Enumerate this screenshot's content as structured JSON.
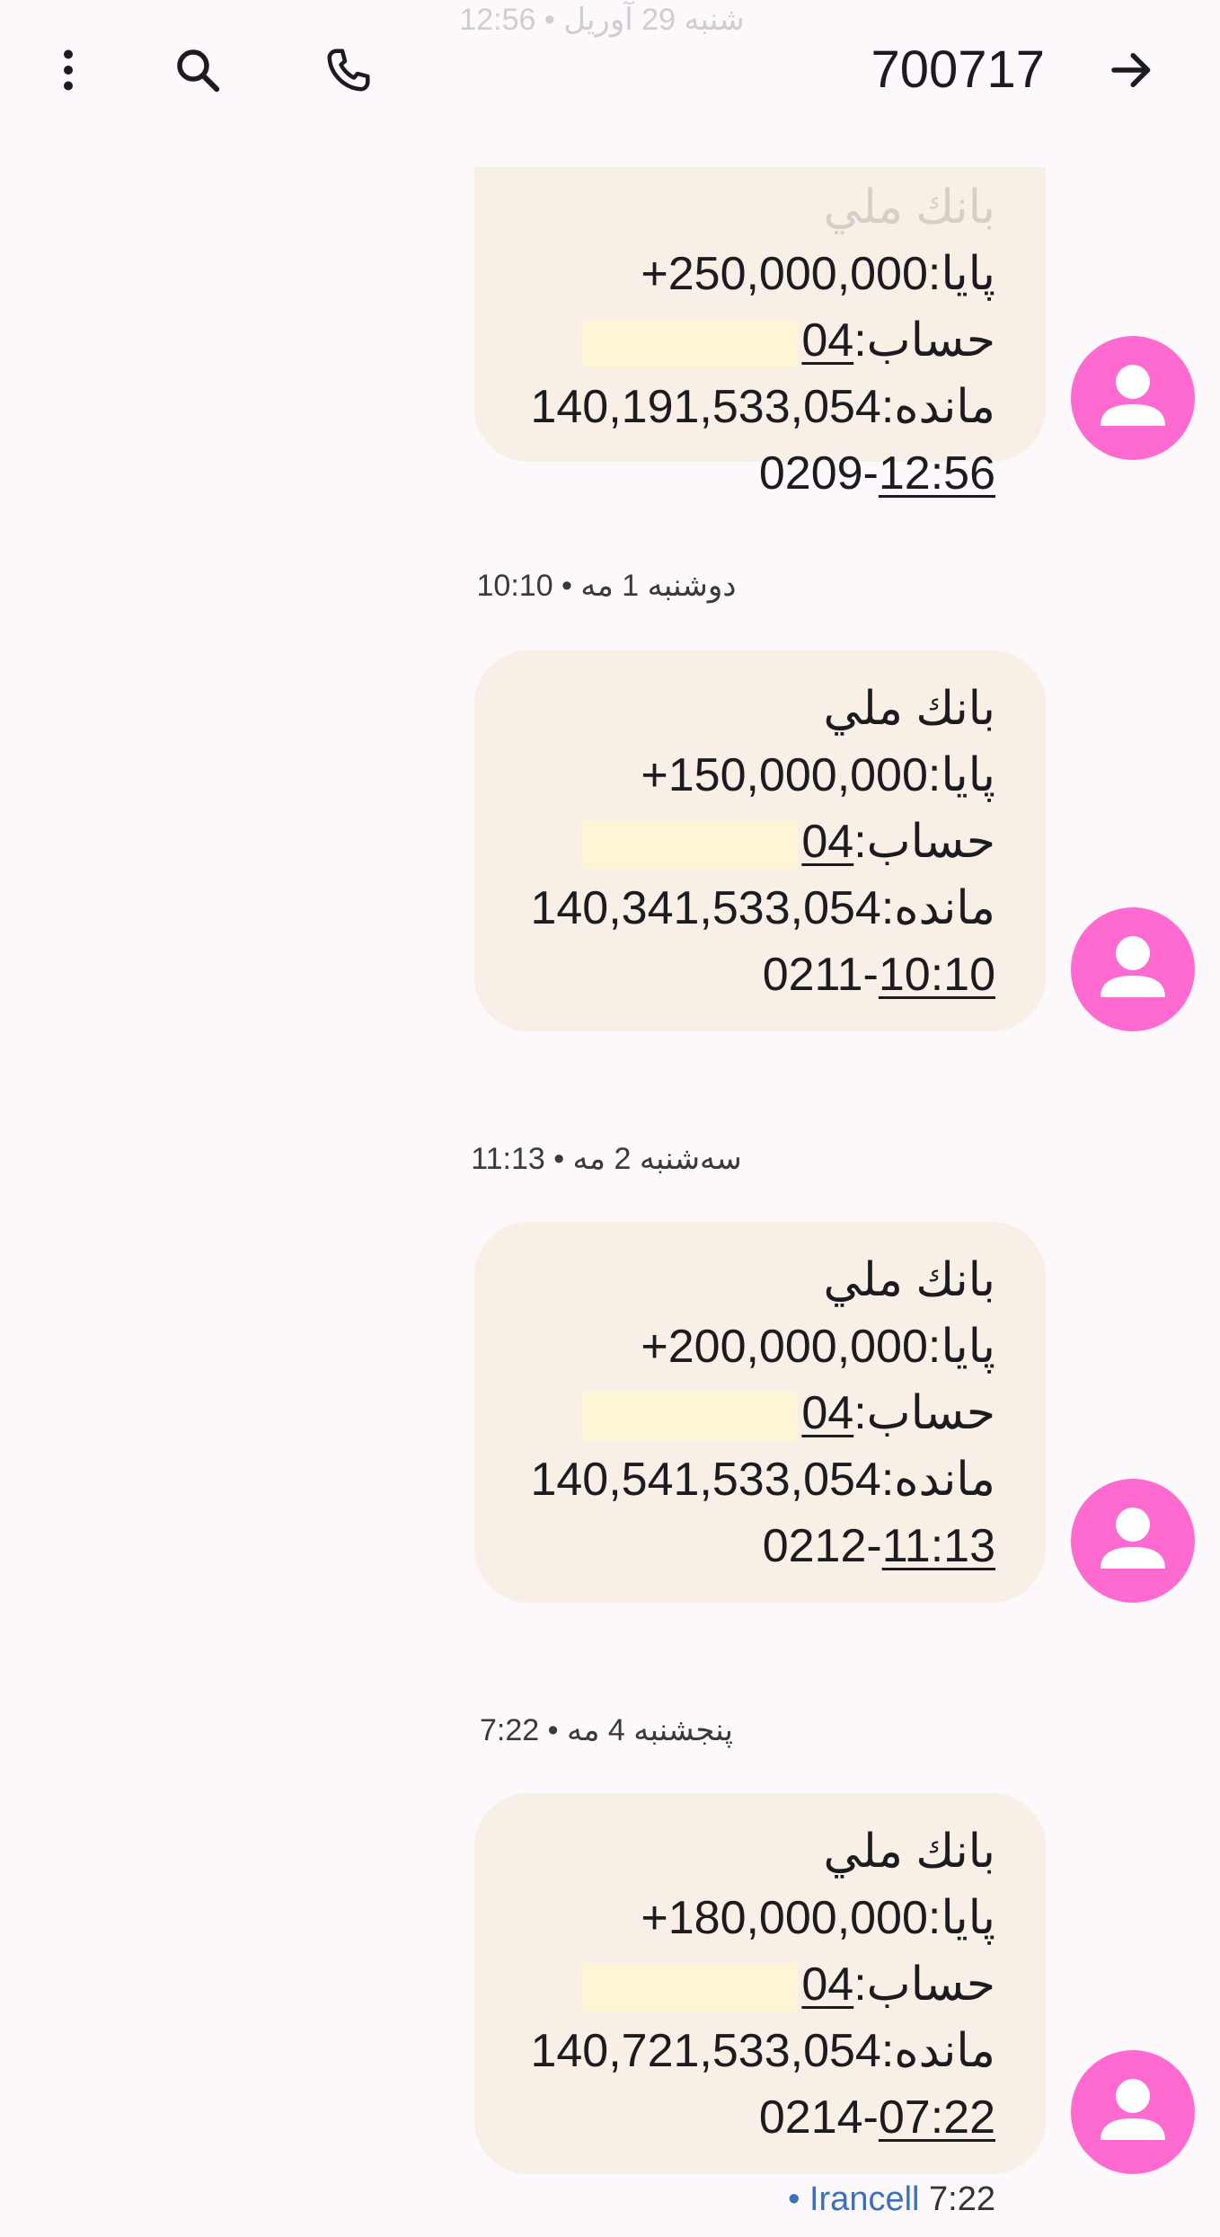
{
  "header": {
    "title": "700717",
    "icons": {
      "back": "arrow-icon",
      "call": "phone-icon",
      "search": "search-icon",
      "menu": "more-vert-icon"
    }
  },
  "colors": {
    "bubble": "#f8efe6",
    "avatar": "#ff6ad0",
    "redaction": "#fef4d6",
    "carrier_link": "#3b6fbf"
  },
  "messages": [
    {
      "date": "شنبه 29 آوریل • 12:56",
      "bank": "بانك ملي",
      "paya_label": "پايا:",
      "amount": "+250,000,000",
      "account_label": "حساب:",
      "account": "04",
      "balance_label": "مانده:",
      "balance": "140,191,533,054",
      "code": "0209-",
      "time": "12:56"
    },
    {
      "date": "دوشنبه 1 مه • 10:10",
      "bank": "بانك ملي",
      "paya_label": "پايا:",
      "amount": "+150,000,000",
      "account_label": "حساب:",
      "account": "04",
      "balance_label": "مانده:",
      "balance": "140,341,533,054",
      "code": "0211-",
      "time": "10:10"
    },
    {
      "date": "سه‌شنبه 2 مه • 11:13",
      "bank": "بانك ملي",
      "paya_label": "پايا:",
      "amount": "+200,000,000",
      "account_label": "حساب:",
      "account": "04",
      "balance_label": "مانده:",
      "balance": "140,541,533,054",
      "code": "0212-",
      "time": "11:13"
    },
    {
      "date": "پنجشنبه 4 مه • 7:22",
      "bank": "بانك ملي",
      "paya_label": "پايا:",
      "amount": "+180,000,000",
      "account_label": "حساب:",
      "account": "04",
      "balance_label": "مانده:",
      "balance": "140,721,533,054",
      "code": "0214-",
      "time": "07:22"
    }
  ],
  "footer": {
    "time": "7:22",
    "carrier": "• Irancell"
  }
}
